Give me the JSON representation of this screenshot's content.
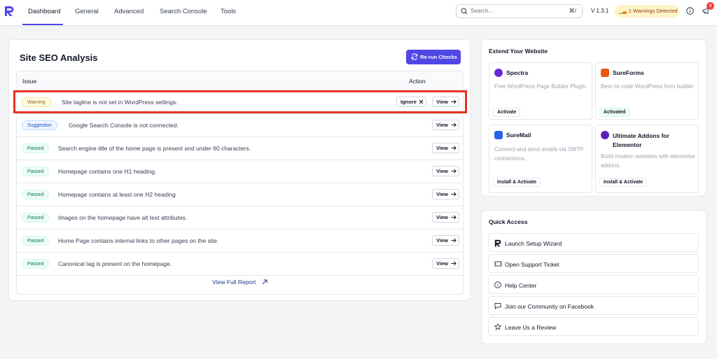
{
  "nav": {
    "tabs": [
      "Dashboard",
      "General",
      "Advanced",
      "Search Console",
      "Tools"
    ],
    "search_placeholder": "Search...",
    "search_shortcut": "⌘/",
    "version": "V 1.3.1",
    "warnings": "1 Warnings Detected",
    "notification_count": "9"
  },
  "seo": {
    "title": "Site SEO Analysis",
    "rerun_label": "Re-run Checks",
    "col_issue": "Issue",
    "col_action": "Action",
    "rows": [
      {
        "status": "Warning",
        "text": "Site tagline is not set in WordPress settings."
      },
      {
        "status": "Suggestion",
        "text": "Google Search Console is not connected."
      },
      {
        "status": "Passed",
        "text": "Search engine title of the home page is present and under 60 characters."
      },
      {
        "status": "Passed",
        "text": "Homepage contains one H1 heading."
      },
      {
        "status": "Passed",
        "text": "Homepage contains at least one H2 heading"
      },
      {
        "status": "Passed",
        "text": "Images on the homepage have alt text attributes."
      },
      {
        "status": "Passed",
        "text": "Home Page contains internal links to other pages on the site."
      },
      {
        "status": "Passed",
        "text": "Canonical tag is present on the homepage."
      }
    ],
    "ignore_label": "Ignore",
    "view_label": "View",
    "view_full_report": "View Full Report"
  },
  "extend": {
    "title": "Extend Your Website",
    "plugins": [
      {
        "name": "Spectra",
        "desc": "Free WordPress Page Builder Plugin.",
        "button": "Activate",
        "color": "#6d28d9"
      },
      {
        "name": "SureForms",
        "desc": "Best no code WordPress form builder",
        "button": "Activated",
        "color": "#ea580c"
      },
      {
        "name": "SureMail",
        "desc": "Connect and send emails via SMTP connections.",
        "button": "Install & Activate",
        "color": "#2563eb"
      },
      {
        "name": "Ultimate Addons for Elementor",
        "desc": "Build modern websites with elementor addons.",
        "button": "Install & Activate",
        "color": "#5b21b6"
      }
    ]
  },
  "quick": {
    "title": "Quick Access",
    "items": [
      "Launch Setup Wizard",
      "Open Support Ticket",
      "Help Center",
      "Join our Community on Facebook",
      "Leave Us a Review"
    ]
  }
}
